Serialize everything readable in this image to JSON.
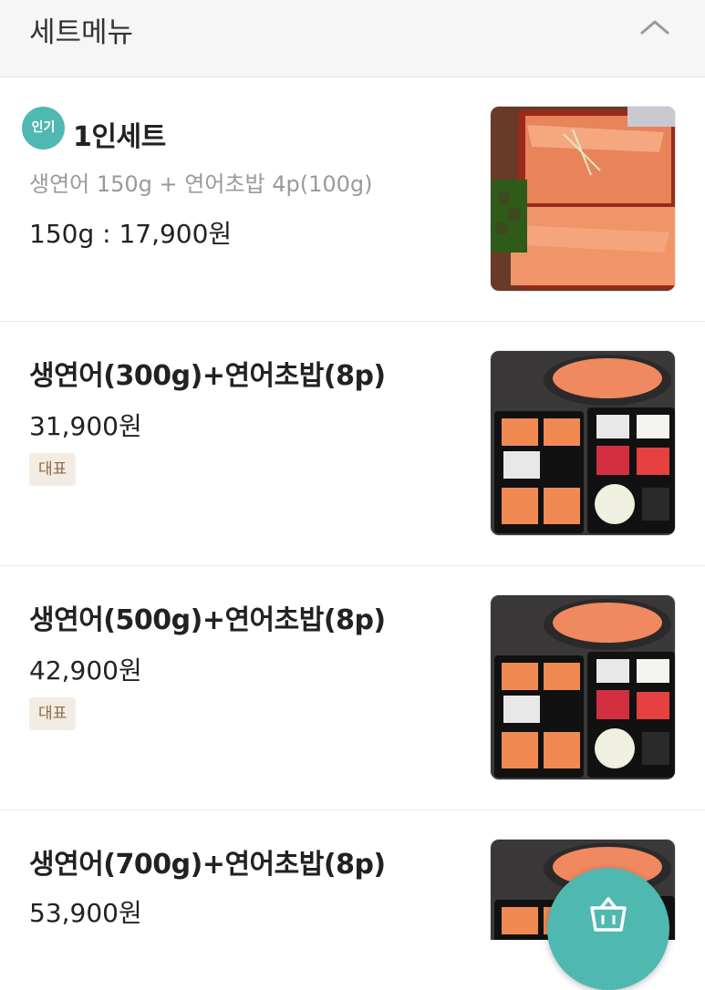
{
  "header": {
    "title": "세트메뉴",
    "toggle_icon": "chevron-up-icon"
  },
  "items": [
    {
      "badge": "인기",
      "name": "1인세트",
      "description": "생연어 150g + 연어초밥 4p(100g)",
      "price": "150g : 17,900원",
      "image": "salmon-single-set-photo"
    },
    {
      "name": "생연어(300g)+연어초밥(8p)",
      "price": "31,900원",
      "tag": "대표",
      "image": "salmon-platter-photo"
    },
    {
      "name": "생연어(500g)+연어초밥(8p)",
      "price": "42,900원",
      "tag": "대표",
      "image": "salmon-platter-photo"
    },
    {
      "name": "생연어(700g)+연어초밥(8p)",
      "price": "53,900원",
      "image": "salmon-platter-photo"
    }
  ],
  "cart_button": {
    "icon": "shopping-basket-icon",
    "color": "#4fb8b0"
  }
}
